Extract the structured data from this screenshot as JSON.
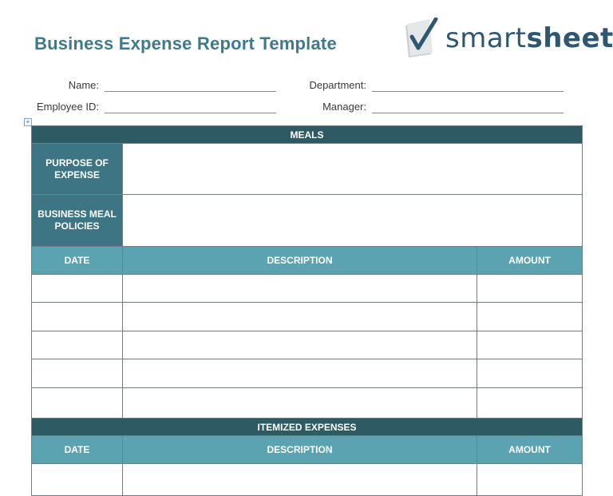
{
  "header": {
    "title": "Business Expense Report Template",
    "logo_text": "smartsheet"
  },
  "fields": {
    "name_label": "Name:",
    "department_label": "Department:",
    "employee_id_label": "Employee ID:",
    "manager_label": "Manager:"
  },
  "meals": {
    "section_title": "MEALS",
    "purpose_label": "PURPOSE OF EXPENSE",
    "policies_label": "BUSINESS MEAL POLICIES",
    "columns": [
      "DATE",
      "DESCRIPTION",
      "AMOUNT"
    ]
  },
  "itemized": {
    "section_title": "ITEMIZED EXPENSES",
    "columns": [
      "DATE",
      "DESCRIPTION",
      "AMOUNT"
    ]
  },
  "colors": {
    "title": "#3f7a8c",
    "section_header": "#2e5a64",
    "row_header": "#3d7584",
    "column_header": "#5ba3b0"
  }
}
